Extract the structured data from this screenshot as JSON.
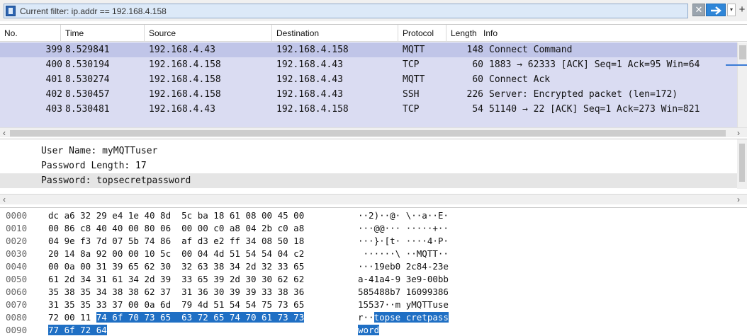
{
  "filter": {
    "text": "Current filter: ip.addr == 192.168.4.158",
    "clear_label": "✕",
    "dropdown_label": "▾",
    "plus_label": "+"
  },
  "packet_list": {
    "columns": [
      "No.",
      "Time",
      "Source",
      "Destination",
      "Protocol",
      "Length",
      "Info"
    ],
    "rows": [
      {
        "no": "399",
        "time": "8.529841",
        "src": "192.168.4.43",
        "dst": "192.168.4.158",
        "proto": "MQTT",
        "len": "148",
        "info": "Connect Command"
      },
      {
        "no": "400",
        "time": "8.530194",
        "src": "192.168.4.158",
        "dst": "192.168.4.43",
        "proto": "TCP",
        "len": "60",
        "info": "1883 → 62333 [ACK] Seq=1 Ack=95 Win=64"
      },
      {
        "no": "401",
        "time": "8.530274",
        "src": "192.168.4.158",
        "dst": "192.168.4.43",
        "proto": "MQTT",
        "len": "60",
        "info": "Connect Ack"
      },
      {
        "no": "402",
        "time": "8.530457",
        "src": "192.168.4.158",
        "dst": "192.168.4.43",
        "proto": "SSH",
        "len": "226",
        "info": "Server: Encrypted packet (len=172)"
      },
      {
        "no": "403",
        "time": "8.530481",
        "src": "192.168.4.43",
        "dst": "192.168.4.158",
        "proto": "TCP",
        "len": "54",
        "info": "51140 → 22 [ACK] Seq=1 Ack=273 Win=821"
      }
    ]
  },
  "details": {
    "lines": [
      "User Name: myMQTTuser",
      "Password Length: 17",
      "Password: topsecretpassword"
    ]
  },
  "bytes": {
    "rows": [
      {
        "offset": "0000",
        "hex": "dc a6 32 29 e4 1e 40 8d  5c ba 18 61 08 00 45 00",
        "ascii": "··2)··@· \\··a··E·"
      },
      {
        "offset": "0010",
        "hex": "00 86 c8 40 40 00 80 06  00 00 c0 a8 04 2b c0 a8",
        "ascii": "···@@··· ·····+··"
      },
      {
        "offset": "0020",
        "hex": "04 9e f3 7d 07 5b 74 86  af d3 e2 ff 34 08 50 18",
        "ascii": "···}·[t· ····4·P·"
      },
      {
        "offset": "0030",
        "hex": "20 14 8a 92 00 00 10 5c  00 04 4d 51 54 54 04 c2",
        "ascii": " ······\\ ··MQTT··"
      },
      {
        "offset": "0040",
        "hex": "00 0a 00 31 39 65 62 30  32 63 38 34 2d 32 33 65",
        "ascii": "···19eb0 2c84-23e"
      },
      {
        "offset": "0050",
        "hex": "61 2d 34 31 61 34 2d 39  33 65 39 2d 30 30 62 62",
        "ascii": "a-41a4-9 3e9-00bb"
      },
      {
        "offset": "0060",
        "hex": "35 38 35 34 38 38 62 37  31 36 30 39 39 33 38 36",
        "ascii": "585488b7 16099386"
      },
      {
        "offset": "0070",
        "hex": "31 35 35 33 37 00 0a 6d  79 4d 51 54 54 75 73 65",
        "ascii": "15537··m yMQTTuse"
      },
      {
        "offset": "0080",
        "hex_plain": "72 00 11 ",
        "hex_hl": "74 6f 70 73 65  63 72 65 74 70 61 73 73",
        "ascii_plain": "r··",
        "ascii_hl": "topse cretpass"
      },
      {
        "offset": "0090",
        "hex_plain": "",
        "hex_hl": "77 6f 72 64",
        "ascii_plain": "",
        "ascii_hl": "word"
      }
    ]
  }
}
